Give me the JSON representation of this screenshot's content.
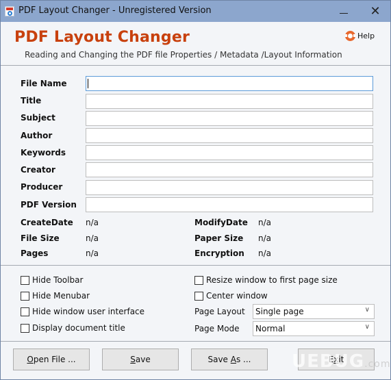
{
  "window": {
    "title": "PDF Layout Changer - Unregistered Version",
    "minimize_label": "minimize",
    "close_glyph": "✕"
  },
  "header": {
    "app_title": "PDF Layout Changer",
    "subtitle": "Reading and Changing the PDF file Properties / Metadata /Layout Information",
    "help_label": "Help",
    "accent_color": "#c8410e"
  },
  "form": {
    "fields": [
      {
        "label": "File Name",
        "value": ""
      },
      {
        "label": "Title",
        "value": ""
      },
      {
        "label": "Subject",
        "value": ""
      },
      {
        "label": "Author",
        "value": ""
      },
      {
        "label": "Keywords",
        "value": ""
      },
      {
        "label": "Creator",
        "value": ""
      },
      {
        "label": "Producer",
        "value": ""
      },
      {
        "label": "PDF Version",
        "value": ""
      }
    ]
  },
  "info": {
    "left": [
      {
        "label": "CreateDate",
        "value": "n/a"
      },
      {
        "label": "File Size",
        "value": "n/a"
      },
      {
        "label": "Pages",
        "value": "n/a"
      }
    ],
    "right": [
      {
        "label": "ModifyDate",
        "value": "n/a"
      },
      {
        "label": "Paper Size",
        "value": "n/a"
      },
      {
        "label": "Encryption",
        "value": "n/a"
      }
    ]
  },
  "options": {
    "checkboxes_left": [
      {
        "label": "Hide Toolbar",
        "checked": false
      },
      {
        "label": "Hide Menubar",
        "checked": false
      },
      {
        "label": "Hide window user interface",
        "checked": false
      },
      {
        "label": "Display document title",
        "checked": false
      }
    ],
    "checkboxes_right": [
      {
        "label": "Resize window to first page size",
        "checked": false
      },
      {
        "label": "Center window",
        "checked": false
      }
    ],
    "page_layout": {
      "label": "Page Layout",
      "value": "Single page"
    },
    "page_mode": {
      "label": "Page Mode",
      "value": "Normal"
    }
  },
  "buttons": {
    "open": {
      "mnemonic": "O",
      "rest": "pen File ..."
    },
    "save": {
      "mnemonic": "S",
      "rest": "ave"
    },
    "save_as": {
      "prefix": "Save ",
      "mnemonic": "A",
      "rest": "s ..."
    },
    "exit": {
      "prefix": "E",
      "mnemonic": "x",
      "rest": "it"
    }
  },
  "watermark": {
    "text": "UEBUG",
    "suffix": ".com"
  }
}
